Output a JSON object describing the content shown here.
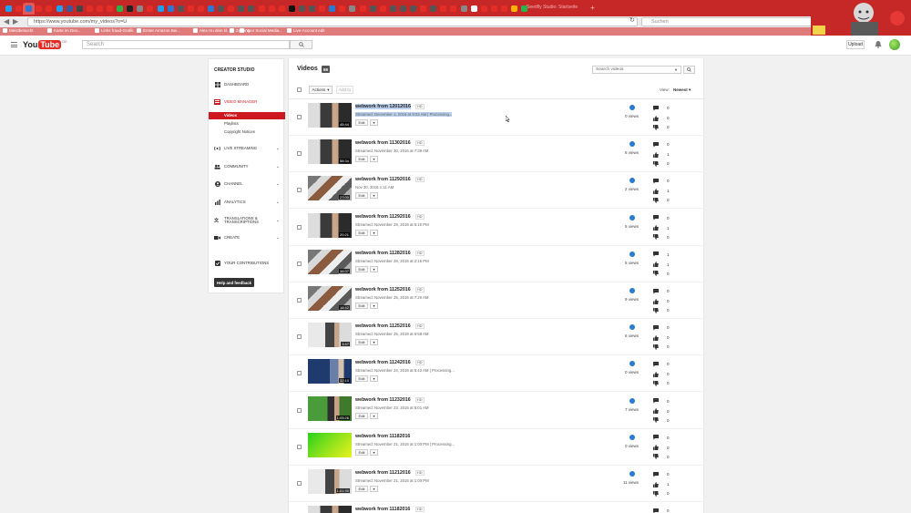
{
  "browser": {
    "tab_title": "Seedfly Studio: Startseite",
    "url": "https://www.youtube.com/my_videos?o=U",
    "search_placeholder": "Suchen",
    "tab_colors": [
      "#1da1f2",
      "#e52d27",
      "#2a7ad4",
      "#e52d27",
      "#e52d27",
      "#1da1f2",
      "#3b5998",
      "#444",
      "#e52d27",
      "#e52d27",
      "#e52d27",
      "#2ab34a",
      "#222",
      "#888",
      "#e52d27",
      "#1da1f2",
      "#2a7ad4",
      "#555",
      "#e52d27",
      "#e52d27",
      "#2a7ad4",
      "#555",
      "#e52d27",
      "#555",
      "#555",
      "#e52d27",
      "#e52d27",
      "#e52d27",
      "#111",
      "#555",
      "#555",
      "#e52d27",
      "#2a7ad4",
      "#e52d27",
      "#888",
      "#e52d27",
      "#555",
      "#e52d27",
      "#555",
      "#555",
      "#555",
      "#e52d27",
      "#555",
      "#e52d27",
      "#e52d27",
      "#888",
      "#fff",
      "#e52d27",
      "#e52d27",
      "#e52d27",
      "#ffb300",
      "#2ab34a"
    ],
    "bookmarks": [
      {
        "label": "Meistbesucht"
      },
      {
        "label": "Karte im Dev..."
      },
      {
        "label": "Links fraud-Grafik"
      },
      {
        "label": "Erster Amazon Bei..."
      },
      {
        "label": "Alex Hu dein kl..."
      },
      {
        "label": "Zugang"
      },
      {
        "label": "Your Social Media..."
      },
      {
        "label": "Live-Account edit"
      }
    ]
  },
  "yt": {
    "logo_you": "You",
    "logo_tube": "Tube",
    "logo_country": "DE",
    "search_placeholder": "Search",
    "upload_label": "Upload"
  },
  "sidebar": {
    "title": "CREATOR STUDIO",
    "items": [
      {
        "label": "DASHBOARD",
        "icon": "dashboard-icon"
      },
      {
        "label": "VIDEO MANAGER",
        "icon": "video-manager-icon"
      },
      {
        "label": "LIVE STREAMING",
        "icon": "live-streaming-icon"
      },
      {
        "label": "COMMUNITY",
        "icon": "community-icon"
      },
      {
        "label": "CHANNEL",
        "icon": "channel-icon"
      },
      {
        "label": "ANALYTICS",
        "icon": "analytics-icon"
      },
      {
        "label": "TRANSLATIONS & TRANSCRIPTIONS",
        "icon": "translations-icon"
      },
      {
        "label": "CREATE",
        "icon": "create-icon"
      },
      {
        "label": "YOUR CONTRIBUTIONS",
        "icon": "contributions-icon"
      }
    ],
    "subitems": [
      "Videos",
      "Playlists",
      "Copyright Notices"
    ],
    "help_label": "Help and feedback"
  },
  "main": {
    "title": "Videos",
    "count": "69",
    "search_placeholder": "Search videos",
    "actions_label": "Actions",
    "addto_label": "Add to",
    "view_label": "View:",
    "view_value": "Newest"
  },
  "videos": [
    {
      "title": "webwork from 12012016",
      "hd": "HD",
      "subtitle": "Streamed: December 1, 2016 at 9:02 AM | Processing...",
      "duration": "45:44",
      "edit": "Edit",
      "views": "0 views",
      "comments": "0",
      "likes": "0",
      "dislikes": "0",
      "thumb": "dark"
    },
    {
      "title": "webwork from 11302016",
      "hd": "HD",
      "subtitle": "Streamed: November 30, 2016 at 7:39 AM",
      "duration": "58:34",
      "edit": "Edit",
      "views": "6 views",
      "comments": "0",
      "likes": "1",
      "dislikes": "0",
      "thumb": "dark"
    },
    {
      "title": "webwork from 11292016",
      "hd": "HD",
      "subtitle": "Nov 30, 2016 1:11 AM",
      "duration": "27:00",
      "edit": "Edit",
      "views": "2 views",
      "comments": "0",
      "likes": "1",
      "dislikes": "0",
      "thumb": "collage"
    },
    {
      "title": "webwork from 11292016",
      "hd": "HD",
      "subtitle": "Streamed: November 29, 2016 at 5:10 PM",
      "duration": "20:21",
      "edit": "Edit",
      "views": "5 views",
      "comments": "0",
      "likes": "1",
      "dislikes": "0",
      "thumb": "dark"
    },
    {
      "title": "webwork from 11282016",
      "hd": "HD",
      "subtitle": "Streamed: November 28, 2016 at 2:15 PM",
      "duration": "34:07",
      "edit": "Edit",
      "views": "5 views",
      "comments": "1",
      "likes": "1",
      "dislikes": "0",
      "thumb": "collage"
    },
    {
      "title": "webwork from 11252016",
      "hd": "HD",
      "subtitle": "Streamed: November 25, 2016 at 7:20 AM",
      "duration": "16:42",
      "edit": "Edit",
      "views": "9 views",
      "comments": "0",
      "likes": "0",
      "dislikes": "0",
      "thumb": "collage"
    },
    {
      "title": "webwork from 11252016",
      "hd": "HD",
      "subtitle": "Streamed: November 25, 2016 at 6:58 AM",
      "duration": "3:47",
      "edit": "Edit",
      "views": "6 views",
      "comments": "0",
      "likes": "0",
      "dislikes": "0",
      "thumb": "light"
    },
    {
      "title": "webwork from 11242016",
      "hd": "HD",
      "subtitle": "Streamed: November 24, 2016 at 5:42 AM | Processing...",
      "duration": "32:10",
      "edit": "Edit",
      "views": "0 views",
      "comments": "0",
      "likes": "0",
      "dislikes": "0",
      "thumb": "blue"
    },
    {
      "title": "webwork from 11232016",
      "hd": "HD",
      "subtitle": "Streamed: November 23, 2016 at 5:01 AM",
      "duration": "1:05:26",
      "edit": "Edit",
      "views": "7 views",
      "comments": "0",
      "likes": "0",
      "dislikes": "0",
      "thumb": "green"
    },
    {
      "title": "webwork from 11182016",
      "hd": "",
      "subtitle": "Streamed: November 21, 2016 at 1:00 PM | Processing...",
      "duration": "",
      "edit": "Edit",
      "views": "0 views",
      "comments": "0",
      "likes": "0",
      "dislikes": "0",
      "thumb": "lime"
    },
    {
      "title": "webwork from 11212016",
      "hd": "HD",
      "subtitle": "Streamed: November 21, 2016 at 1:00 PM",
      "duration": "1:01:30",
      "edit": "Edit",
      "views": "11 views",
      "comments": "0",
      "likes": "1",
      "dislikes": "0",
      "thumb": "light"
    },
    {
      "title": "webwork from 11182016",
      "hd": "HD",
      "subtitle": "",
      "duration": "",
      "edit": "Edit",
      "views": "",
      "comments": "0",
      "likes": "",
      "dislikes": "",
      "thumb": "dark"
    }
  ],
  "colors": {
    "accent": "#cc181e",
    "tabstrip": "#c62828",
    "bookmarks": "#e07b7b",
    "selection": "#b9d0ef"
  }
}
